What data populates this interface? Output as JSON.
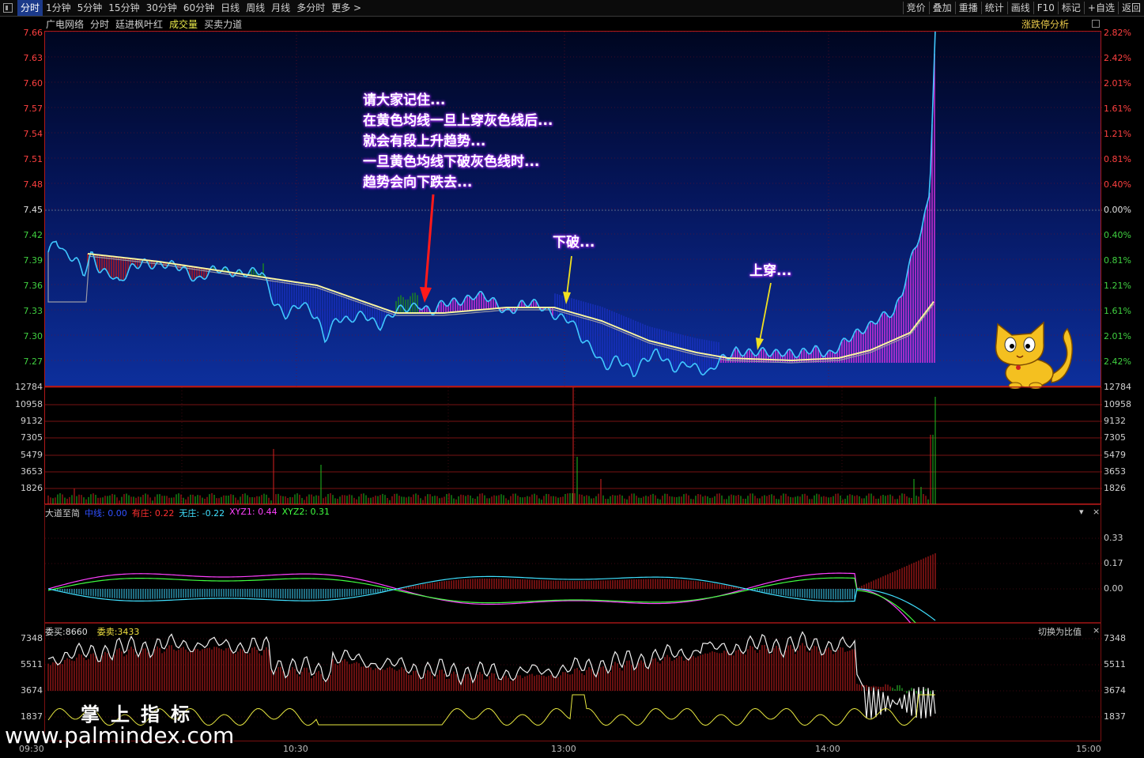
{
  "toolbar": {
    "left": [
      "分时",
      "1分钟",
      "5分钟",
      "15分钟",
      "30分钟",
      "60分钟",
      "日线",
      "周线",
      "月线",
      "多分时",
      "更多 >"
    ],
    "right": [
      "竞价",
      "叠加",
      "重播",
      "统计",
      "画线",
      "F10",
      "标记",
      "+自选",
      "返回"
    ]
  },
  "main": {
    "stock": "广电网络",
    "mode": "分时",
    "signal": "廷进枫叶红",
    "volume_label": "成交量",
    "power_label": "买卖力道",
    "analysis_label": "涨跌停分析",
    "price_ticks": [
      "7.66",
      "7.63",
      "7.60",
      "7.57",
      "7.54",
      "7.51",
      "7.48",
      "7.45",
      "7.42",
      "7.39",
      "7.36",
      "7.33",
      "7.30",
      "7.27"
    ],
    "pct_ticks": [
      "2.82%",
      "2.42%",
      "2.01%",
      "1.61%",
      "1.21%",
      "0.81%",
      "0.40%",
      "0.00%",
      "0.40%",
      "0.81%",
      "1.21%",
      "1.61%",
      "2.01%",
      "2.42%"
    ],
    "annotation_lines": [
      "请大家记住...",
      "在黄色均线一旦上穿灰色线后...",
      "就会有段上升趋势...",
      "一旦黄色均线下破灰色线时...",
      "趋势会向下跌去..."
    ],
    "label_break_down": "下破...",
    "label_break_up": "上穿..."
  },
  "volume": {
    "ticks": [
      "12784",
      "10958",
      "9132",
      "7305",
      "5479",
      "3653",
      "1826"
    ]
  },
  "indicator": {
    "name": "大道至简",
    "items": [
      {
        "label": "中线",
        "value": "0.00",
        "color": "#3050ff"
      },
      {
        "label": "有庄",
        "value": "0.22",
        "color": "#ff3030"
      },
      {
        "label": "无庄",
        "value": "-0.22",
        "color": "#40e0ff"
      },
      {
        "label": "XYZ1",
        "value": "0.44",
        "color": "#ff40ff"
      },
      {
        "label": "XYZ2",
        "value": "0.31",
        "color": "#40ff40"
      }
    ],
    "ticks": [
      "0.33",
      "0.17",
      "0.00"
    ]
  },
  "orders": {
    "buy_label": "委买:8660",
    "sell_label": "委卖:3433",
    "switch_label": "切换为比值",
    "ticks": [
      "7348",
      "5511",
      "3674",
      "1837"
    ]
  },
  "time_axis": [
    "09:30",
    "10:30",
    "13:00",
    "14:00",
    "15:00"
  ],
  "watermark": {
    "title": "掌上指标",
    "url": "www.palmindex.com"
  }
}
